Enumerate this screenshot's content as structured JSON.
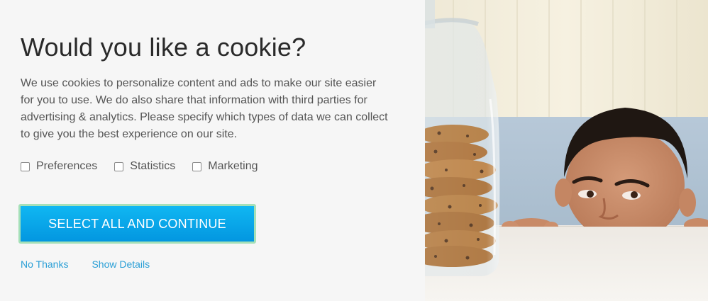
{
  "dialog": {
    "title": "Would you like a cookie?",
    "description": "We use cookies to personalize content and ads to make our site easier for you to use. We do also share that information with third parties for advertising & analytics. Please specify which types of data we can collect to give you the best experience on our site.",
    "options": [
      {
        "label": "Preferences",
        "checked": false
      },
      {
        "label": "Statistics",
        "checked": false
      },
      {
        "label": "Marketing",
        "checked": false
      }
    ],
    "primary_button": "SELECT ALL AND CONTINUE",
    "links": {
      "no_thanks": "No Thanks",
      "show_details": "Show Details"
    }
  },
  "colors": {
    "button_top": "#10b7f2",
    "button_bottom": "#0396e0",
    "button_border": "#a5e0b8",
    "link": "#2a9fd6",
    "title": "#2a2a2a",
    "background": "#f6f6f6"
  },
  "image": {
    "subject": "boy-peeking-at-cookie-jar"
  }
}
